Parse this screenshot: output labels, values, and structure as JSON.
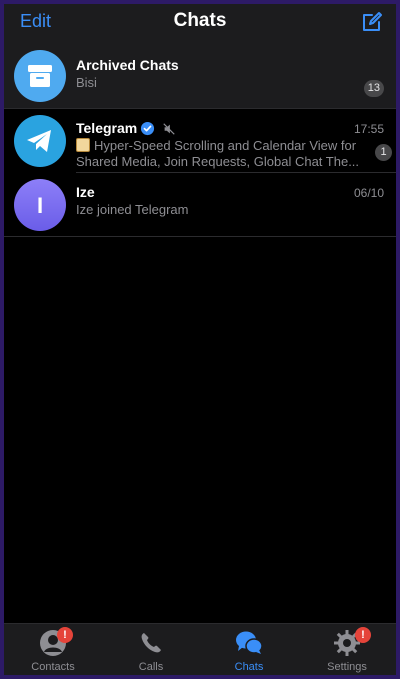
{
  "header": {
    "edit_label": "Edit",
    "title": "Chats",
    "compose_icon": "compose-icon"
  },
  "archived": {
    "name": "Archived Chats",
    "preview": "Bisi",
    "count": "13",
    "icon": "archive-box-icon",
    "avatar_color": "#4faaf0"
  },
  "chats": [
    {
      "name": "Telegram",
      "time": "17:55",
      "preview_line1": "Hyper-Speed Scrolling and Calendar View for",
      "preview_line2": "Shared Media, Join Requests, Global Chat The...",
      "unread": "1",
      "verified_icon": "verified-badge-icon",
      "muted_icon": "muted-speaker-icon",
      "avatar_color": "#2aa3e0"
    },
    {
      "name": "Ize",
      "time": "06/10",
      "preview": "Ize joined Telegram",
      "avatar_letter": "I",
      "avatar_color": "#7b6bf2"
    }
  ],
  "tabbar": {
    "tabs": [
      {
        "label": "Contacts",
        "icon": "person-icon",
        "badge": "!"
      },
      {
        "label": "Calls",
        "icon": "phone-icon"
      },
      {
        "label": "Chats",
        "icon": "chat-bubbles-icon",
        "active": true
      },
      {
        "label": "Settings",
        "icon": "gear-icon",
        "badge": "!"
      }
    ]
  },
  "colors": {
    "accent": "#3a8ef7",
    "badge_red": "#e5443a"
  }
}
